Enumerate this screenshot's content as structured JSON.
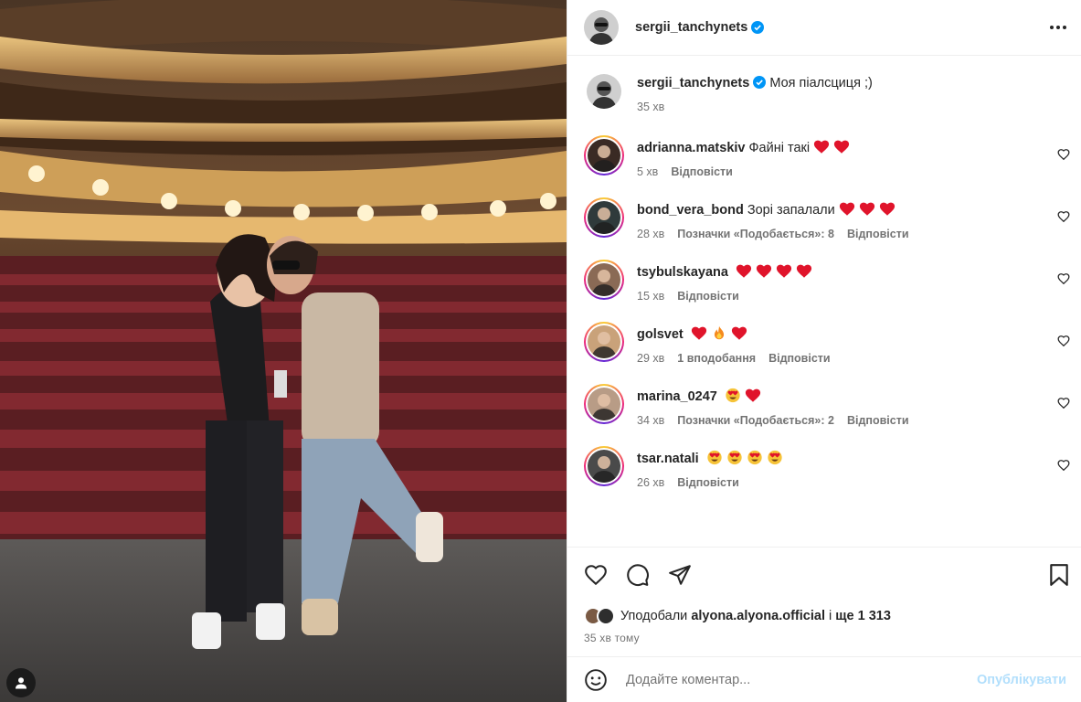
{
  "post": {
    "author": "sergii_tanchynets",
    "caption": "Моя піалсциця ;)",
    "caption_time": "35 хв"
  },
  "comments": [
    {
      "user": "adrianna.matskiv",
      "text": "Файні такі",
      "emojis": [
        "heart",
        "heart"
      ],
      "time": "5 хв",
      "likes": "",
      "reply": "Відповісти",
      "avatar_color": "#3a2a24"
    },
    {
      "user": "bond_vera_bond",
      "text": "Зорі запалали",
      "emojis": [
        "heart",
        "heart",
        "heart"
      ],
      "time": "28 хв",
      "likes": "Позначки «Подобається»: 8",
      "reply": "Відповісти",
      "avatar_color": "#2f3a3b"
    },
    {
      "user": "tsybulskayana",
      "text": "",
      "emojis": [
        "heart",
        "heart",
        "heart",
        "heart"
      ],
      "time": "15 хв",
      "likes": "",
      "reply": "Відповісти",
      "avatar_color": "#8a6a55"
    },
    {
      "user": "golsvet",
      "text": "",
      "emojis": [
        "heart",
        "fire",
        "heart"
      ],
      "time": "29 хв",
      "likes": "1 вподобання",
      "reply": "Відповісти",
      "avatar_color": "#c9a27a"
    },
    {
      "user": "marina_0247",
      "text": "",
      "emojis": [
        "heart-eyes",
        "heart"
      ],
      "time": "34 хв",
      "likes": "Позначки «Подобається»: 2",
      "reply": "Відповісти",
      "avatar_color": "#b89c86"
    },
    {
      "user": "tsar.natali",
      "text": "",
      "emojis": [
        "heart-eyes",
        "heart-eyes",
        "heart-eyes",
        "heart-eyes"
      ],
      "time": "26 хв",
      "likes": "",
      "reply": "Відповісти",
      "avatar_color": "#4a4a4a"
    }
  ],
  "likes_line": {
    "prefix": "Уподобали",
    "user": "alyona.alyona.official",
    "middle": "і",
    "rest": "ще 1 313"
  },
  "time_ago": "35 хв тому",
  "add_comment": {
    "placeholder": "Додайте коментар...",
    "post_label": "Опублікувати"
  },
  "colors": {
    "heart": "#e0142b",
    "verified": "#0095f6",
    "post_disabled": "#b2dffc"
  }
}
